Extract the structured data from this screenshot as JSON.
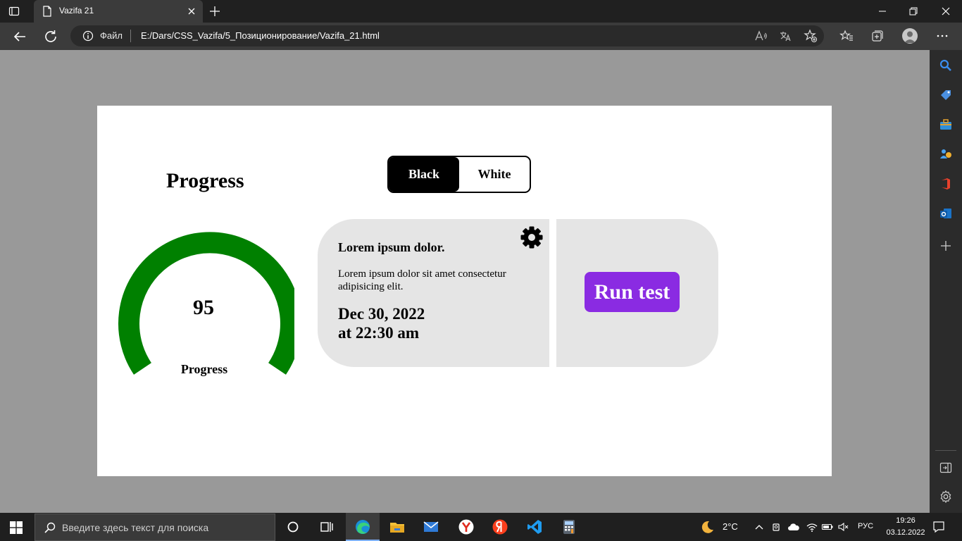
{
  "browser": {
    "tab_title": "Vazifa 21",
    "address_prefix": "Файл",
    "url": "E:/Dars/CSS_Vazifa/5_Позиционирование/Vazifa_21.html"
  },
  "page": {
    "progress_title": "Progress",
    "gauge": {
      "value": "95",
      "label": "Progress",
      "color": "#008000"
    },
    "toggle": {
      "black_label": "Black",
      "white_label": "White"
    },
    "card": {
      "heading": "Lorem ipsum dolor.",
      "text": "Lorem ipsum dolor sit amet consectetur adipisicing elit.",
      "date_line1": "Dec 30, 2022",
      "date_line2": "at 22:30 am"
    },
    "run_button": {
      "label": "Run test",
      "color": "#8a2be2"
    }
  },
  "taskbar": {
    "search_placeholder": "Введите здесь текст для поиска",
    "weather": "2°C",
    "language": "РУС",
    "time": "19:26",
    "date": "03.12.2022"
  }
}
